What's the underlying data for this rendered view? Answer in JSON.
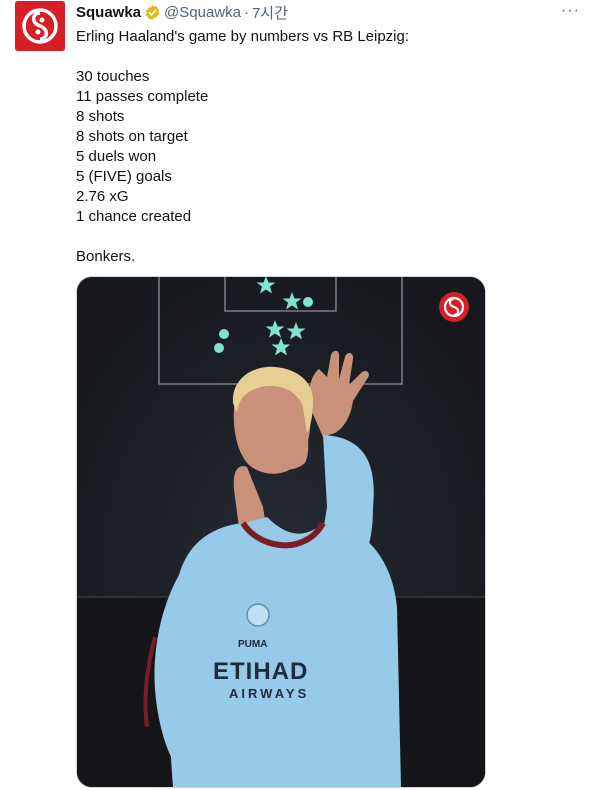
{
  "tweet": {
    "author": {
      "name": "Squawka",
      "handle": "@Squawka",
      "separator": "·",
      "time": "7시간",
      "avatar_color": "#d61f26",
      "verified_badge_color": "#e2b719"
    },
    "more_label": "···",
    "lines": [
      "Erling Haaland's game by numbers vs RB Leipzig:",
      "",
      "30 touches",
      "11 passes complete",
      "8 shots",
      "8 shots on target",
      "5 duels won",
      "5 (FIVE) goals",
      "2.76 xG",
      "1 chance created",
      "",
      "Bonkers."
    ],
    "media": {
      "jersey_sponsor_line1": "ETIHAD",
      "jersey_sponsor_line2": "AIRWAYS",
      "pitch_color": "#1b1e24",
      "marker_color": "#7fe3cf",
      "jersey_color": "#97c9e8"
    }
  }
}
